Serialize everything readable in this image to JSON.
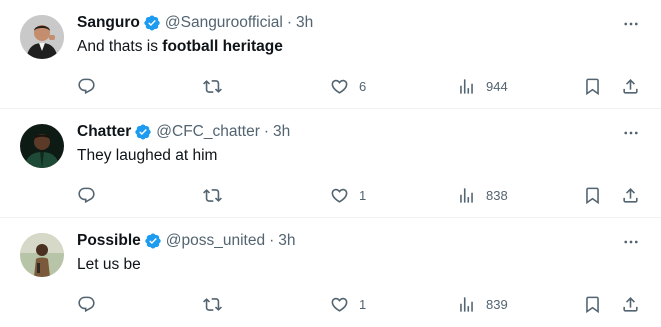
{
  "tweets": [
    {
      "name": "Sanguro",
      "handle": "@Sanguroofficial",
      "dot": "·",
      "time": "3h",
      "text_plain": "And thats is ",
      "text_bold": "football heritage",
      "likes": "6",
      "views": "944",
      "avatar_desc": "man in black suit"
    },
    {
      "name": "Chatter",
      "handle": "@CFC_chatter",
      "dot": "·",
      "time": "3h",
      "text_plain": "They laughed at him",
      "text_bold": "",
      "likes": "1",
      "views": "838",
      "avatar_desc": "man in green jacket"
    },
    {
      "name": "Possible",
      "handle": "@poss_united",
      "dot": "·",
      "time": "3h",
      "text_plain": "Let us be",
      "text_bold": "",
      "likes": "1",
      "views": "839",
      "avatar_desc": "person standing outdoors"
    }
  ],
  "colors": {
    "verified": "#1d9bf0",
    "muted": "#536471",
    "text": "#0f1419",
    "divider": "#eff3f4"
  },
  "icons": [
    "verified-badge-icon",
    "more-icon",
    "reply-icon",
    "retweet-icon",
    "like-icon",
    "views-icon",
    "bookmark-icon",
    "share-icon"
  ]
}
